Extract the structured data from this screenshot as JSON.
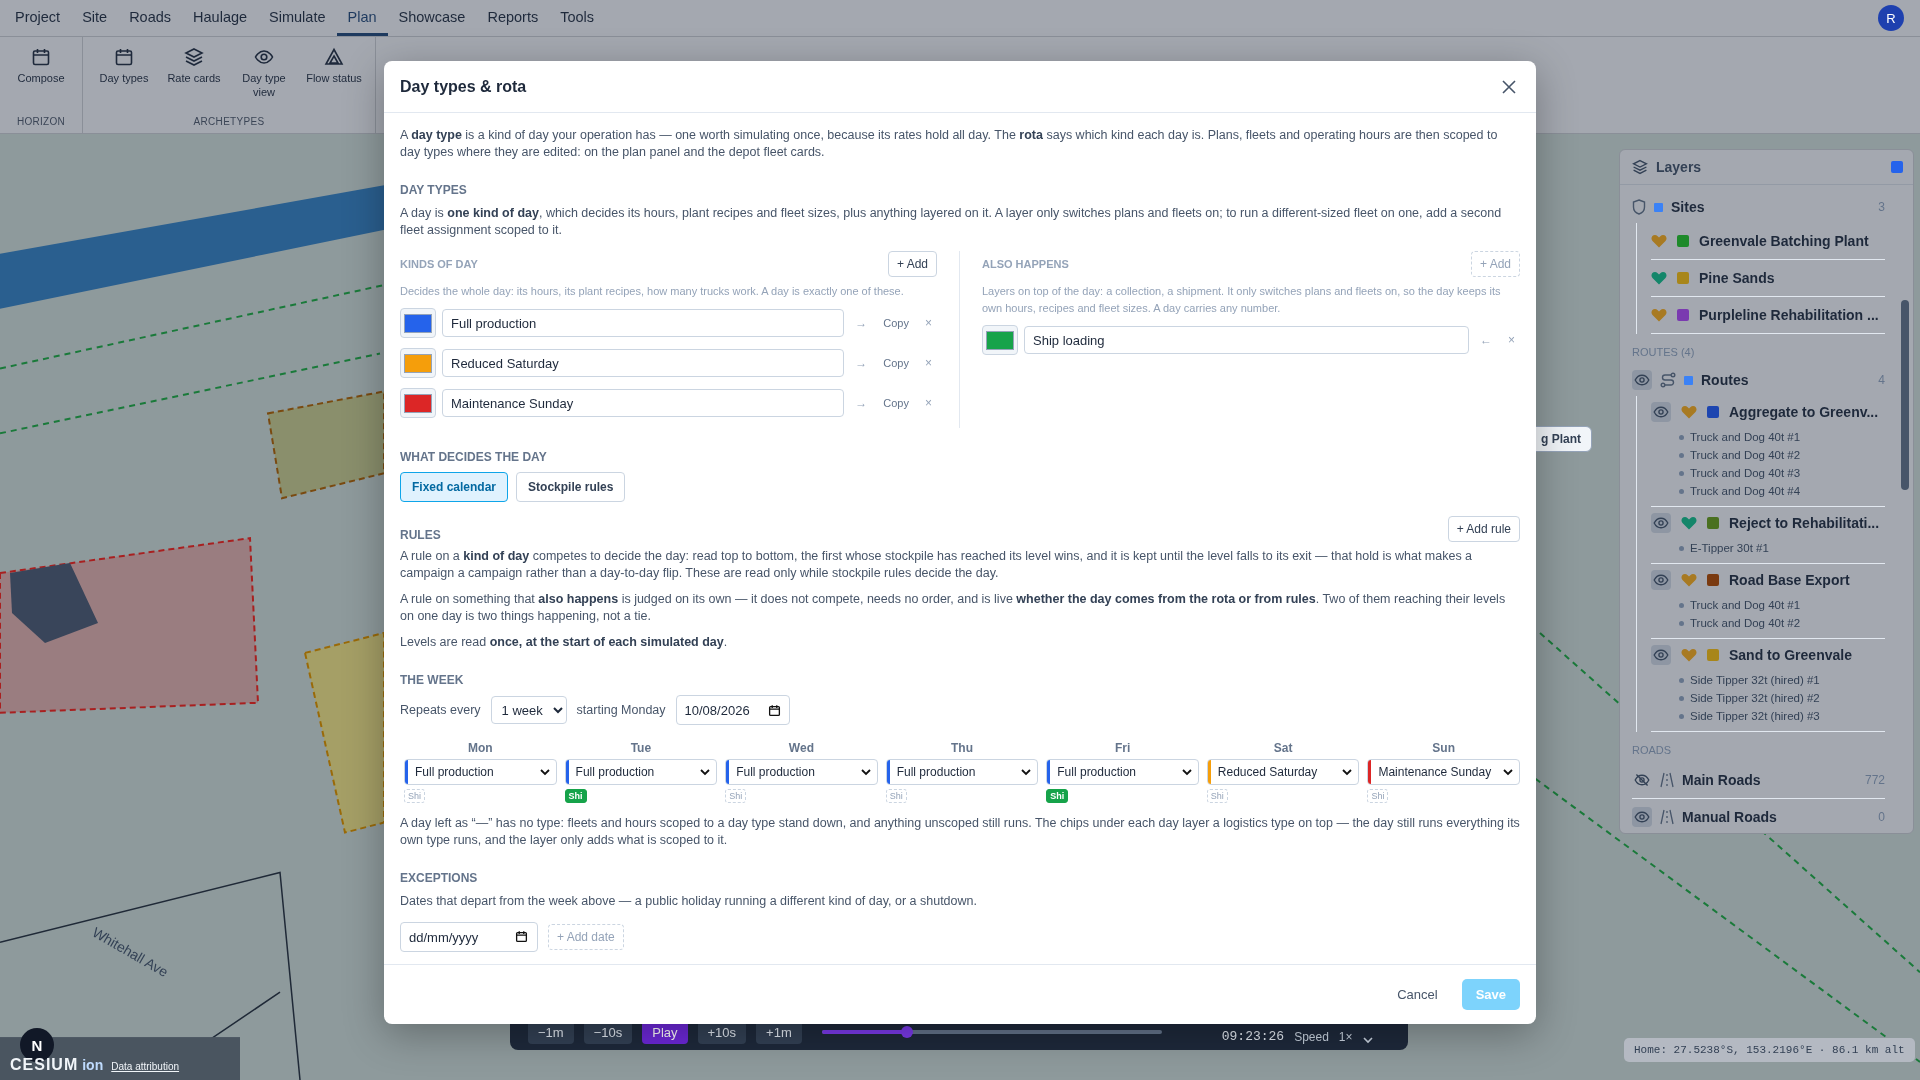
{
  "menu": [
    {
      "label": "Project",
      "selected": false
    },
    {
      "label": "Site",
      "selected": false
    },
    {
      "label": "Roads",
      "selected": false
    },
    {
      "label": "Haulage",
      "selected": false
    },
    {
      "label": "Simulate",
      "selected": false
    },
    {
      "label": "Plan",
      "selected": true
    },
    {
      "label": "Showcase",
      "selected": false
    },
    {
      "label": "Reports",
      "selected": false
    },
    {
      "label": "Tools",
      "selected": false
    }
  ],
  "user_avatar": "R",
  "ribbon": [
    {
      "label": "HORIZON",
      "tools": [
        {
          "label": "Compose",
          "kind": "calendar"
        }
      ]
    },
    {
      "label": "ARCHETYPES",
      "tools": [
        {
          "label": "Day types",
          "kind": "calendar"
        },
        {
          "label": "Rate cards",
          "kind": "layers"
        },
        {
          "label": "Day type view",
          "kind": "eye"
        },
        {
          "label": "Flow status",
          "kind": "triangle"
        }
      ]
    }
  ],
  "map": {
    "road_label": "Whitehall Ave",
    "site_label": "g Plant",
    "compass": "N",
    "logo": "CESIUM",
    "logo_suffix": "ion",
    "attribution": "Data attribution"
  },
  "layers_panel": {
    "title": "Layers",
    "sites": {
      "label": "Sites",
      "count": "3",
      "items": [
        {
          "name": "Greenvale Batching Plant",
          "color": "#1e8a2a",
          "healthy": false
        },
        {
          "name": "Pine Sands",
          "color": "#a8861a",
          "healthy": true
        },
        {
          "name": "Purpleline Rehabilitation ...",
          "color": "#7a3ab0",
          "healthy": false
        }
      ]
    },
    "routes_heading": "ROUTES (4)",
    "routes": {
      "label": "Routes",
      "count": "4",
      "visible": true,
      "items": [
        {
          "name": "Aggregate to Greenv...",
          "color": "#1d45b0",
          "healthy": false,
          "visible": true,
          "trucks": [
            "Truck and Dog 40t #1",
            "Truck and Dog 40t #2",
            "Truck and Dog 40t #3",
            "Truck and Dog 40t #4"
          ]
        },
        {
          "name": "Reject to Rehabilitati...",
          "color": "#4a7020",
          "healthy": true,
          "visible": true,
          "trucks": [
            "E-Tipper 30t #1"
          ]
        },
        {
          "name": "Road Base Export",
          "color": "#7a3a10",
          "healthy": false,
          "visible": true,
          "trucks": [
            "Truck and Dog 40t #1",
            "Truck and Dog 40t #2"
          ]
        },
        {
          "name": "Sand to Greenvale",
          "color": "#a8861a",
          "healthy": false,
          "visible": true,
          "trucks": [
            "Side Tipper 32t (hired) #1",
            "Side Tipper 32t (hired) #2",
            "Side Tipper 32t (hired) #3"
          ]
        }
      ]
    },
    "roads_heading": "ROADS",
    "roads": [
      {
        "name": "Main Roads",
        "count": "772",
        "visible": false
      },
      {
        "name": "Manual Roads",
        "count": "0",
        "visible": true
      }
    ]
  },
  "playback": {
    "buttons": [
      {
        "label": "−1m",
        "selected": false
      },
      {
        "label": "−10s",
        "selected": false
      },
      {
        "label": "Play",
        "selected": true
      },
      {
        "label": "+10s",
        "selected": false
      },
      {
        "label": "+1m",
        "selected": false
      }
    ],
    "level": 0.25,
    "time": "09:23:26",
    "speed_label": "Speed",
    "speed": "1×"
  },
  "status_bar": "Home: 27.5238°S, 153.2196°E · 86.1 km alt",
  "dialog": {
    "title": "Day types & rota",
    "intro": "A **day type** is a kind of day your operation has — one worth simulating once, because its rates hold all day. The **rota** says which kind each day is. Plans, fleets and operating hours are then scoped to day types where they are edited: on the plan panel and the depot fleet cards.",
    "day_types_heading": "DAY TYPES",
    "day_types_text": "A day is **one kind of day**, which decides its hours, plant recipes and fleet sizes, plus anything layered on it. A layer only switches plans and fleets on; to run a different-sized fleet on one, add a second fleet assignment scoped to it.",
    "kinds": {
      "heading": "KINDS OF DAY",
      "add": {
        "label": "+ Add",
        "disabled": false
      },
      "hint": "Decides the whole day: its hours, its plant recipes, how many trucks work. A day is exactly one of these.",
      "items": [
        {
          "name": "Full production",
          "color": "#2563eb",
          "move": "→",
          "copy": "Copy",
          "remove": "×"
        },
        {
          "name": "Reduced Saturday",
          "color": "#f59e0b",
          "move": "→",
          "copy": "Copy",
          "remove": "×"
        },
        {
          "name": "Maintenance Sunday",
          "color": "#dc2626",
          "move": "→",
          "copy": "Copy",
          "remove": "×"
        }
      ]
    },
    "also": {
      "heading": "ALSO HAPPENS",
      "add": {
        "label": "+ Add",
        "disabled": true
      },
      "hint": "Layers on top of the day: a collection, a shipment. It only switches plans and fleets on, so the day keeps its own hours, recipes and fleet sizes. A day carries any number.",
      "items": [
        {
          "name": "Ship loading",
          "color": "#16a34a",
          "move": "←",
          "remove": "×"
        }
      ]
    },
    "decides_heading": "WHAT DECIDES THE DAY",
    "decides": [
      {
        "label": "Fixed calendar",
        "selected": true
      },
      {
        "label": "Stockpile rules",
        "selected": false
      }
    ],
    "rules_heading": "RULES",
    "add_rule": "+ Add rule",
    "rules": [
      "A rule on a **kind of day** competes to decide the day: read top to bottom, the first whose stockpile has reached its level wins, and it is kept until the level falls to its exit — that hold is what makes a campaign a campaign rather than a day-to-day flip. These are read only while stockpile rules decide the day.",
      "A rule on something that **also happens** is judged on its own — it does not compete, needs no order, and is live **whether the day comes from the rota or from rules**. Two of them reaching their levels on one day is two things happening, not a tie.",
      "Levels are read **once, at the start of each simulated day**."
    ],
    "week": {
      "heading": "THE WEEK",
      "repeats_label": "Repeats every",
      "repeats": "1 week",
      "start_label": "starting Monday",
      "start_date": "10/08/2026",
      "days": [
        {
          "name": "Mon",
          "type": "Full production",
          "color": "#2563eb",
          "chip": "Shi",
          "on": false
        },
        {
          "name": "Tue",
          "type": "Full production",
          "color": "#2563eb",
          "chip": "Shi",
          "on": true
        },
        {
          "name": "Wed",
          "type": "Full production",
          "color": "#2563eb",
          "chip": "Shi",
          "on": false
        },
        {
          "name": "Thu",
          "type": "Full production",
          "color": "#2563eb",
          "chip": "Shi",
          "on": false
        },
        {
          "name": "Fri",
          "type": "Full production",
          "color": "#2563eb",
          "chip": "Shi",
          "on": true
        },
        {
          "name": "Sat",
          "type": "Reduced Saturday",
          "color": "#f59e0b",
          "chip": "Shi",
          "on": false
        },
        {
          "name": "Sun",
          "type": "Maintenance Sunday",
          "color": "#dc2626",
          "chip": "Shi",
          "on": false
        }
      ],
      "note": "A day left as “—” has no type: fleets and hours scoped to a day type stand down, and anything unscoped still runs. The chips under each day layer a logistics type on top — the day still runs everything its own type runs, and the layer only adds what is scoped to it."
    },
    "exceptions": {
      "heading": "EXCEPTIONS",
      "text": "Dates that depart from the week above — a public holiday running a different kind of day, or a shutdown.",
      "placeholder": "dd/mm/yyyy",
      "add": {
        "label": "+ Add date",
        "disabled": true
      }
    },
    "cancel": "Cancel",
    "save": {
      "label": "Save",
      "disabled": true
    }
  }
}
